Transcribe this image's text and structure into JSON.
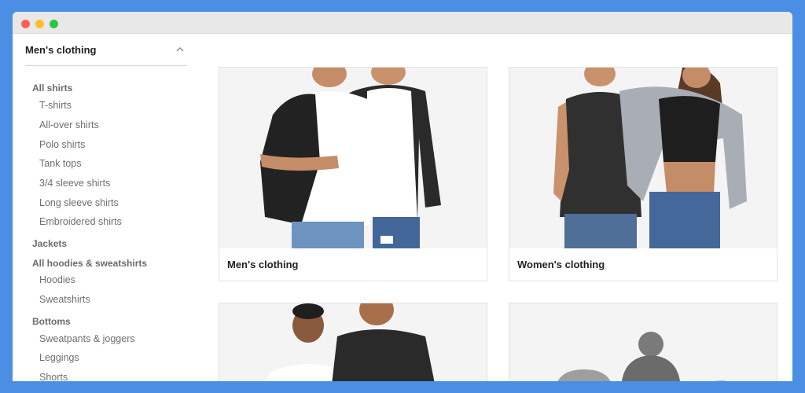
{
  "sidebar": {
    "title": "Men's clothing",
    "groups": [
      {
        "label": "All shirts",
        "items": [
          "T-shirts",
          "All-over shirts",
          "Polo shirts",
          "Tank tops",
          "3/4 sleeve shirts",
          "Long sleeve shirts",
          "Embroidered shirts"
        ]
      },
      {
        "label": "Jackets",
        "items": []
      },
      {
        "label": "All hoodies & sweatshirts",
        "items": [
          "Hoodies",
          "Sweatshirts"
        ]
      },
      {
        "label": "Bottoms",
        "items": [
          "Sweatpants & joggers",
          "Leggings",
          "Shorts"
        ]
      }
    ]
  },
  "cards": [
    {
      "label": "Men's clothing"
    },
    {
      "label": "Women's clothing"
    },
    {
      "label": ""
    },
    {
      "label": ""
    }
  ],
  "icons": {
    "collapse": "chevron-up-icon"
  },
  "colors": {
    "frame": "#4a8fe3",
    "titlebar": "#e8e8e8",
    "heading": "#1f1f1f",
    "link": "#6f6f6f"
  }
}
